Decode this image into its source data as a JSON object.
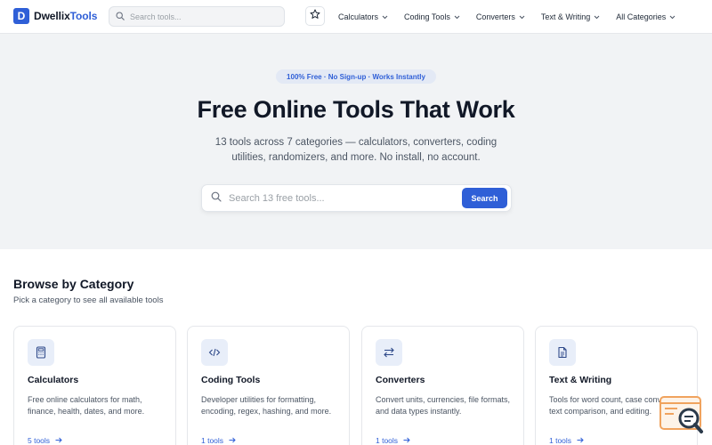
{
  "brand": {
    "mark": "D",
    "name_part1": "Dwellix",
    "name_part2": "Tools"
  },
  "nav": {
    "search_placeholder": "Search tools...",
    "links": [
      {
        "label": "Calculators"
      },
      {
        "label": "Coding Tools"
      },
      {
        "label": "Converters"
      },
      {
        "label": "Text & Writing"
      },
      {
        "label": "All Categories"
      }
    ]
  },
  "hero": {
    "badge": "100% Free · No Sign-up · Works Instantly",
    "title": "Free Online Tools That Work",
    "subtitle": "13 tools across 7 categories — calculators, converters, coding utilities, randomizers, and more. No install, no account.",
    "search_placeholder": "Search 13 free tools...",
    "search_button": "Search"
  },
  "categories": {
    "title": "Browse by Category",
    "subtitle": "Pick a category to see all available tools",
    "cards": [
      {
        "icon": "calculator-icon",
        "title": "Calculators",
        "description": "Free online calculators for math, finance, health, dates, and more.",
        "link": "5 tools"
      },
      {
        "icon": "code-icon",
        "title": "Coding Tools",
        "description": "Developer utilities for formatting, encoding, regex, hashing, and more.",
        "link": "1 tools"
      },
      {
        "icon": "swap-arrows-icon",
        "title": "Converters",
        "description": "Convert units, currencies, file formats, and data types instantly.",
        "link": "1 tools"
      },
      {
        "icon": "document-icon",
        "title": "Text & Writing",
        "description": "Tools for word count, case conversion, text comparison, and editing.",
        "link": "1 tools"
      }
    ]
  },
  "colors": {
    "accent": "#2f5fd7",
    "hero_bg": "#f1f3f5",
    "widget": "#f0a35e"
  }
}
